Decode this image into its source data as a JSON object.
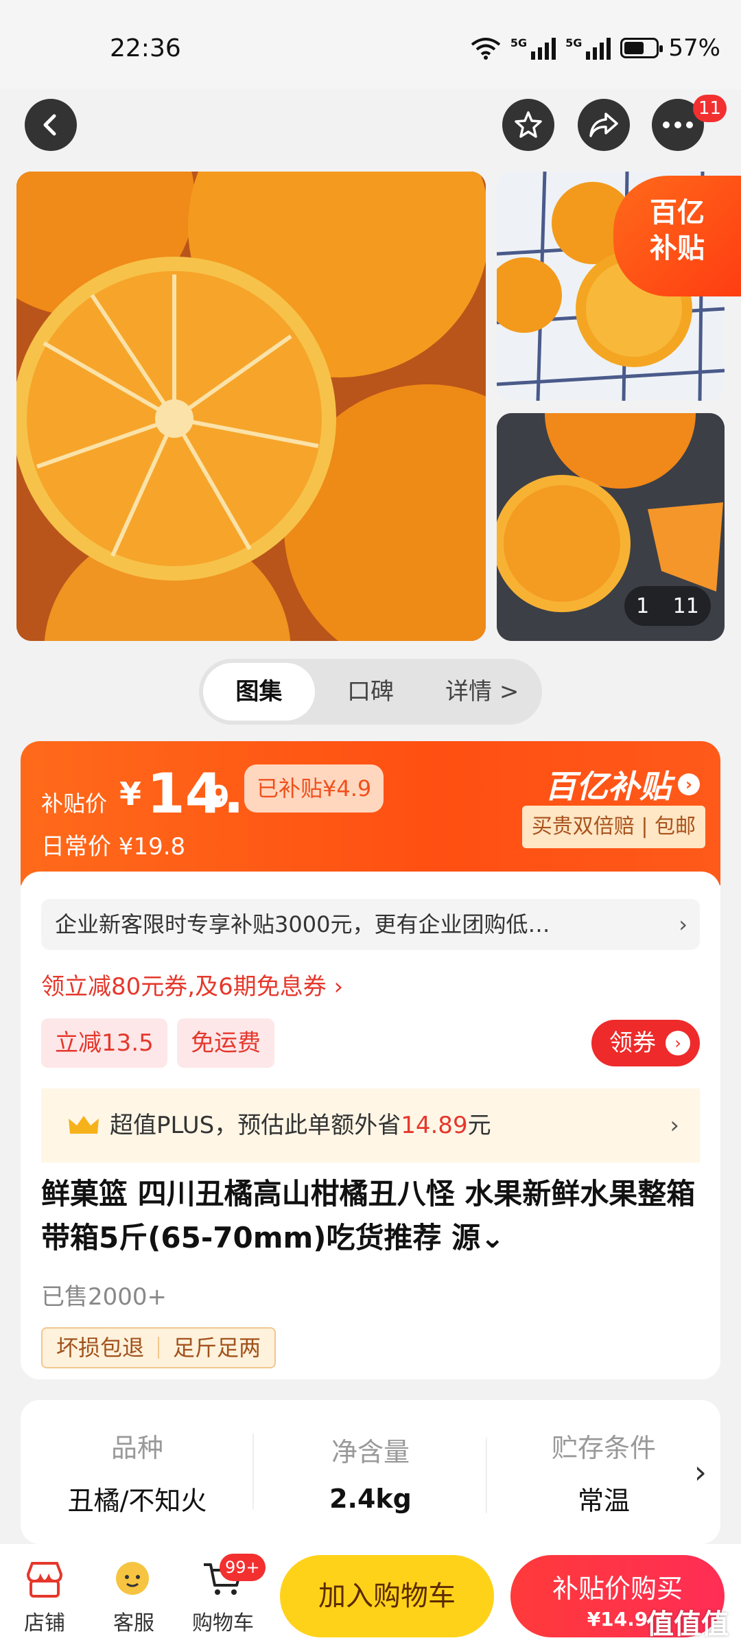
{
  "status_bar": {
    "time": "22:36",
    "net1": "5G",
    "net2": "5G",
    "battery": "57%"
  },
  "nav": {
    "more_badge": "11"
  },
  "gallery": {
    "promo_tag": "百亿\n补贴",
    "page_current": "1",
    "page_total": "11"
  },
  "tabs": [
    {
      "label": "图集",
      "active": true
    },
    {
      "label": "口碑"
    },
    {
      "label": "详情 >"
    }
  ],
  "price": {
    "label": "补贴价",
    "yen": "¥",
    "integer": "14.",
    "decimal": "9",
    "subsidy_chip": "已补贴¥4.9",
    "daily_label": "日常价 ¥19.8",
    "brand": "百亿补贴",
    "promise": "买贵双倍赔 | 包邮"
  },
  "promo": {
    "business_bar": "企业新客限时专享补贴3000元，更有企业团购低…",
    "coupon_line": "领立减80元券,及6期免息券 ›",
    "chip_discount": "立减13.5",
    "chip_shipping": "免运费",
    "get_coupon": "领券",
    "plus_text": "超值PLUS，预估此单额外省",
    "plus_amount": "14.89",
    "plus_unit": "元"
  },
  "product": {
    "title": "鲜菓篮 四川丑橘高山柑橘丑八怪  水果新鲜水果整箱 带箱5斤(65-70mm)吃货推荐 源⌄",
    "sold": "已售2000+",
    "guarantee1": "坏损包退",
    "guarantee2": "足斤足两"
  },
  "specs": [
    {
      "key": "品种",
      "value": "丑橘/不知火"
    },
    {
      "key": "净含量",
      "value": "2.4kg"
    },
    {
      "key": "贮存条件",
      "value": "常温"
    }
  ],
  "bottom": {
    "shop": "店铺",
    "service": "客服",
    "cart": "购物车",
    "cart_badge": "99+",
    "add_to_cart": "加入购物车",
    "buy_line1": "补贴价购买",
    "buy_line2": "¥14.9"
  },
  "watermark": "值值值",
  "colors": {
    "accent_orange": "#ff5a1a",
    "accent_red": "#ee2a2a",
    "cart_yellow": "#ffd21a"
  }
}
